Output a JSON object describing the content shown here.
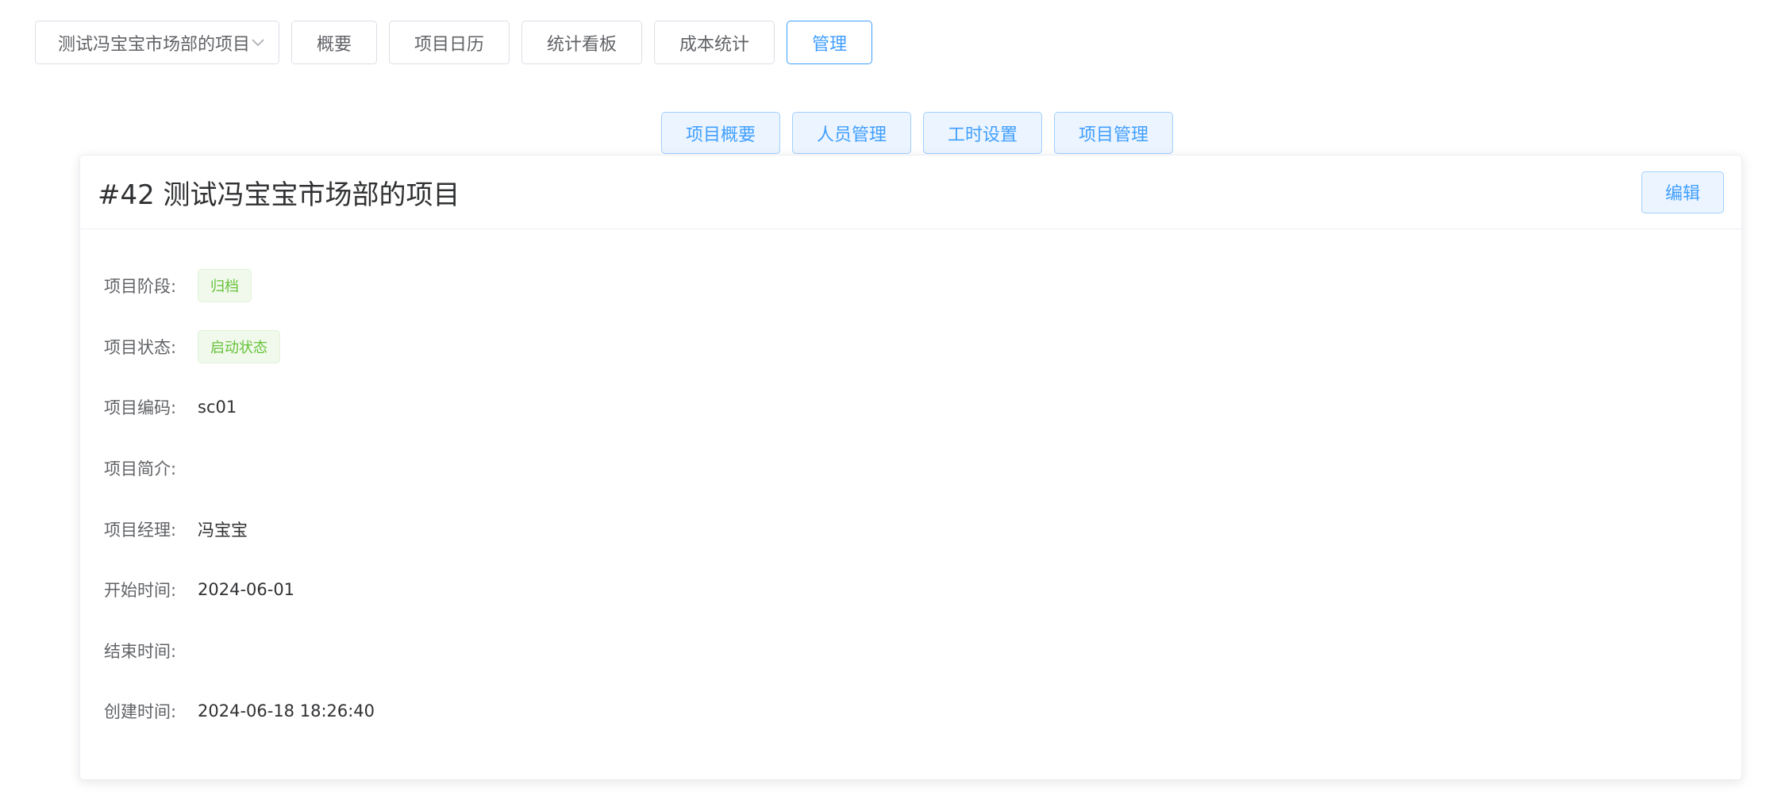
{
  "topnav": {
    "project_select": "测试冯宝宝市场部的项目",
    "buttons": [
      "概要",
      "项目日历",
      "统计看板",
      "成本统计",
      "管理"
    ]
  },
  "subtabs": [
    "项目概要",
    "人员管理",
    "工时设置",
    "项目管理"
  ],
  "card": {
    "title": "#42 测试冯宝宝市场部的项目",
    "edit_label": "编辑",
    "fields": {
      "stage": {
        "label": "项目阶段:",
        "value": "归档"
      },
      "status": {
        "label": "项目状态:",
        "value": "启动状态"
      },
      "code": {
        "label": "项目编码:",
        "value": "sc01"
      },
      "intro": {
        "label": "项目简介:",
        "value": ""
      },
      "manager": {
        "label": "项目经理:",
        "value": "冯宝宝"
      },
      "start": {
        "label": "开始时间:",
        "value": "2024-06-01"
      },
      "end": {
        "label": "结束时间:",
        "value": ""
      },
      "created": {
        "label": "创建时间:",
        "value": "2024-06-18 18:26:40"
      }
    }
  },
  "colors": {
    "primary": "#409eff",
    "success": "#67c23a",
    "border": "#dcdfe6"
  }
}
